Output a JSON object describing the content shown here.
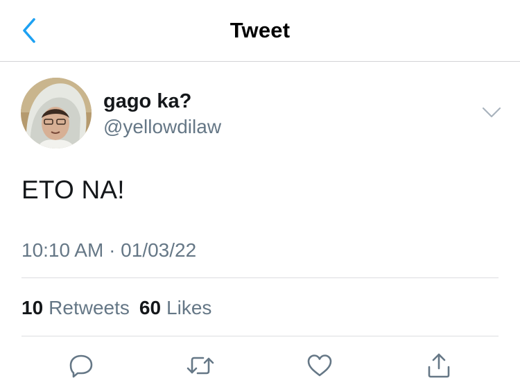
{
  "header": {
    "title": "Tweet",
    "back_icon": "chevron-left-icon"
  },
  "tweet": {
    "author": {
      "display_name": "gago ka?",
      "handle": "@yellowdilaw"
    },
    "text": "ETO NA!",
    "timestamp": "10:10 AM · 01/03/22",
    "stats": {
      "retweets_count": "10",
      "retweets_label": "Retweets",
      "likes_count": "60",
      "likes_label": "Likes"
    }
  },
  "actions": [
    {
      "icon": "reply-icon"
    },
    {
      "icon": "retweet-icon"
    },
    {
      "icon": "like-icon"
    },
    {
      "icon": "share-icon"
    }
  ],
  "colors": {
    "accent": "#1da1f2",
    "text_primary": "#14171a",
    "text_secondary": "#657786",
    "divider": "#dcdde0"
  }
}
